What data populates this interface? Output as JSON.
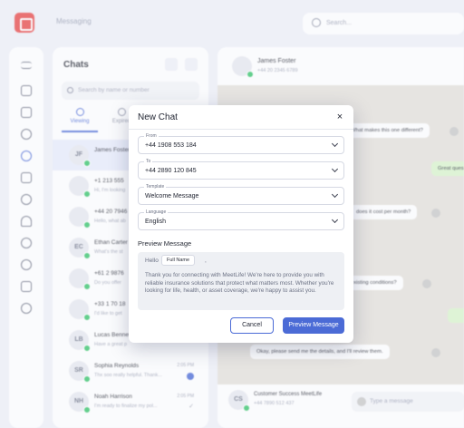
{
  "topbar": {
    "breadcrumb": "Messaging",
    "search_placeholder": "Search..."
  },
  "chats": {
    "title": "Chats",
    "search_placeholder": "Search by name or number",
    "tabs": [
      {
        "label": "Viewing"
      },
      {
        "label": "Expired"
      }
    ],
    "rows": [
      {
        "initials": "JF",
        "name": "James Foster",
        "preview": "",
        "time": "",
        "badge": false
      },
      {
        "initials": "",
        "name": "+1 213 555",
        "preview": "Hi, I'm looking",
        "time": "",
        "badge": false
      },
      {
        "initials": "",
        "name": "+44 20 7946",
        "preview": "Hello, what ab",
        "time": "",
        "badge": false
      },
      {
        "initials": "EC",
        "name": "Ethan Carter",
        "preview": "What's the st",
        "time": "",
        "badge": false
      },
      {
        "initials": "",
        "name": "+61 2 9876",
        "preview": "Do you offer",
        "time": "",
        "badge": false
      },
      {
        "initials": "",
        "name": "+33 1 70 18",
        "preview": "I'd like to get",
        "time": "",
        "badge": false
      },
      {
        "initials": "LB",
        "name": "Lucas Bennet",
        "preview": "Have a great p",
        "time": "",
        "badge": false
      },
      {
        "initials": "SR",
        "name": "Sophia Reynolds",
        "preview": "Thx soo really helpful. Thank...",
        "time": "2:05 PM",
        "badge": true
      },
      {
        "initials": "NH",
        "name": "Noah Harrison",
        "preview": "I'm ready to finalize my pol...",
        "time": "2:05 PM",
        "badge": false
      }
    ]
  },
  "conversation": {
    "contact_initials": "",
    "contact_name": "James Foster",
    "contact_phone": "+44 20 2345 6789",
    "messages": [
      {
        "text": "What makes this one different?",
        "dir": "in"
      },
      {
        "text": "Great ques",
        "dir": "out"
      },
      {
        "text": "does it cost per month?",
        "dir": "in"
      },
      {
        "text": "existing conditions?",
        "dir": "in"
      },
      {
        "text": "Okay, please send me the details, and I'll review them.",
        "dir": "in"
      }
    ],
    "footer_initials": "CS",
    "footer_name": "Customer Success MeetLife",
    "footer_phone": "+44 7890 512 437",
    "message_placeholder": "Type a message"
  },
  "modal": {
    "title": "New Chat",
    "close_icon": "×",
    "from_label": "From",
    "from_value": "+44 1908 553 184",
    "to_label": "To",
    "to_value": "+44 2890 120 845",
    "template_label": "Template",
    "template_value": "Welcome Message",
    "language_label": "Language",
    "language_value": "English",
    "preview_label": "Preview Message",
    "preview_greeting": "Hello",
    "preview_chip": "Full Name",
    "preview_comma": ",",
    "preview_body": "Thank you for connecting with MeetLife! We're here to provide you with reliable insurance solutions that protect what matters most. Whether you're looking for life, health, or asset coverage, we're happy to assist you.",
    "cancel_label": "Cancel",
    "preview_button_label": "Preview Message"
  },
  "colors": {
    "accent": "#4b6bd6",
    "online": "#35c46a",
    "brand": "#e84848"
  }
}
